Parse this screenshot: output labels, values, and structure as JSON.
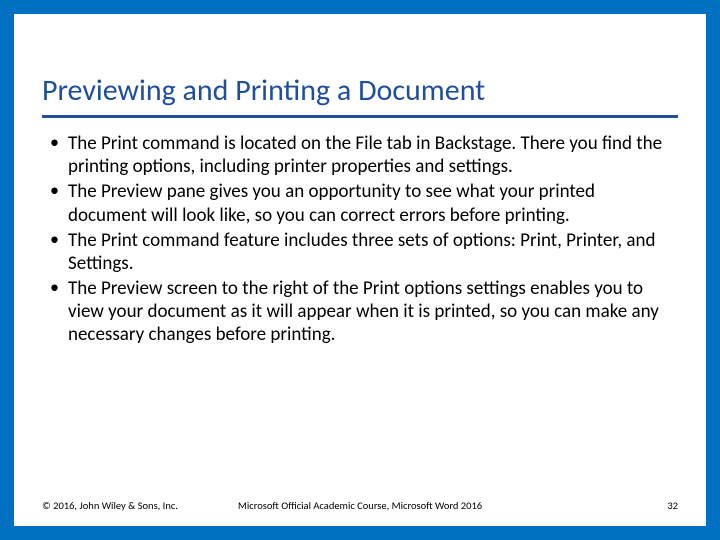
{
  "title": "Previewing and Printing a Document",
  "bullets": [
    "The Print command is located on the File tab in Backstage. There you find the printing options, including printer properties and settings.",
    "The Preview pane gives you an opportunity to see what your printed document will look like, so you can correct errors before printing.",
    "The Print command feature includes three sets of options: Print, Printer, and Settings.",
    "The Preview screen to the right of the Print options settings enables you to view your document as it will appear when it is printed, so you can make any necessary changes before printing."
  ],
  "footer": {
    "left": "© 2016, John Wiley & Sons, Inc.",
    "center": "Microsoft Official Academic Course, Microsoft Word 2016",
    "page": "32"
  }
}
